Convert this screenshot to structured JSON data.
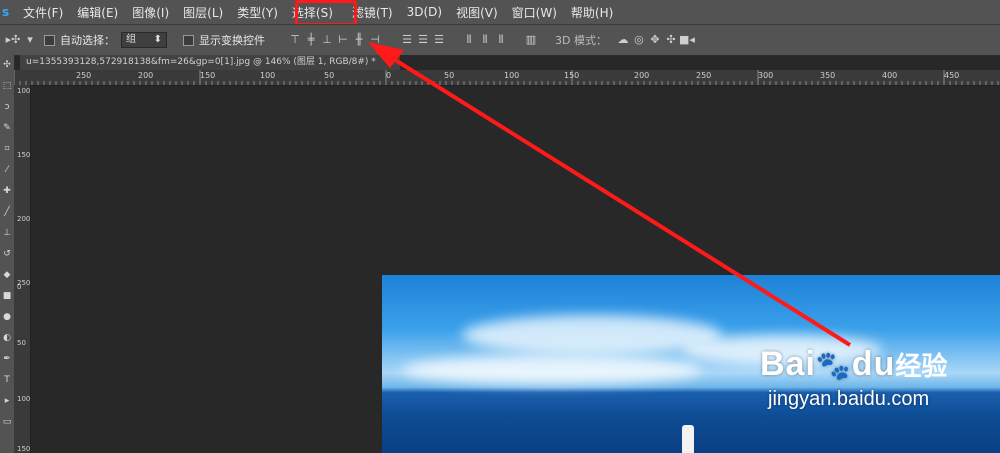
{
  "app": {
    "logo": "s"
  },
  "menu": [
    {
      "label": "文件(F)"
    },
    {
      "label": "编辑(E)"
    },
    {
      "label": "图像(I)"
    },
    {
      "label": "图层(L)"
    },
    {
      "label": "类型(Y)"
    },
    {
      "label": "选择(S)"
    },
    {
      "label": "滤镜(T)"
    },
    {
      "label": "3D(D)"
    },
    {
      "label": "视图(V)"
    },
    {
      "label": "窗口(W)"
    },
    {
      "label": "帮助(H)"
    }
  ],
  "options": {
    "auto_select_label": "自动选择：",
    "auto_select_value": "组",
    "show_transform_label": "显示变换控件",
    "mode_3d_label": "3D 模式："
  },
  "document": {
    "tab_title": "u=1355393128,572918138&fm=26&gp=0[1].jpg @ 146% (图层 1, RGB/8#) *",
    "close": "×"
  },
  "ruler": {
    "h_ticks": [
      "250",
      "200",
      "150",
      "100",
      "50",
      "0",
      "50",
      "100",
      "150",
      "200",
      "250",
      "300",
      "350",
      "400",
      "450"
    ],
    "v_ticks": [
      "100",
      "150",
      "200",
      "250",
      "0",
      "50",
      "100",
      "150"
    ]
  },
  "watermark": {
    "brand": "Bai",
    "brand2": "du",
    "cn": "经验",
    "url": "jingyan.baidu.com"
  },
  "colors": {
    "highlight": "#ff1a1a",
    "arrow": "#ff1a1a",
    "ui_bg": "#535353",
    "canvas_bg": "#282828"
  }
}
